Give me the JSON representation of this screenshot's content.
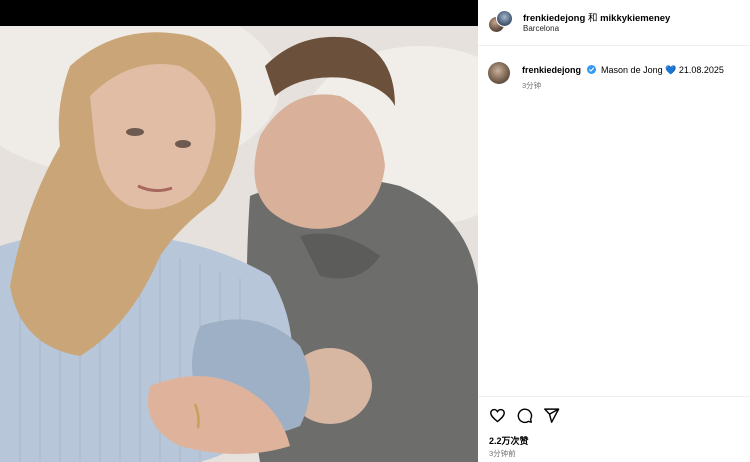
{
  "header": {
    "user1": "frenkiedejong",
    "joiner": "和",
    "user2": "mikkykiemeney",
    "location": "Barcelona",
    "more_icon": "more-horizontal-icon"
  },
  "caption": {
    "username": "frenkiedejong",
    "verified_icon": "verified-badge-icon",
    "text_before_heart": "Mason de Jong",
    "heart": "💙",
    "text_after_heart": "21.08.2025",
    "time": "3分钟"
  },
  "actions": {
    "like_icon": "heart-icon",
    "comment_icon": "comment-icon",
    "share_icon": "share-icon"
  },
  "likes": "2.2万次赞",
  "post_time": "3分钟前",
  "colors": {
    "verified": "#3897f0",
    "heart": "#3b82f6",
    "meta_text": "#737373"
  }
}
